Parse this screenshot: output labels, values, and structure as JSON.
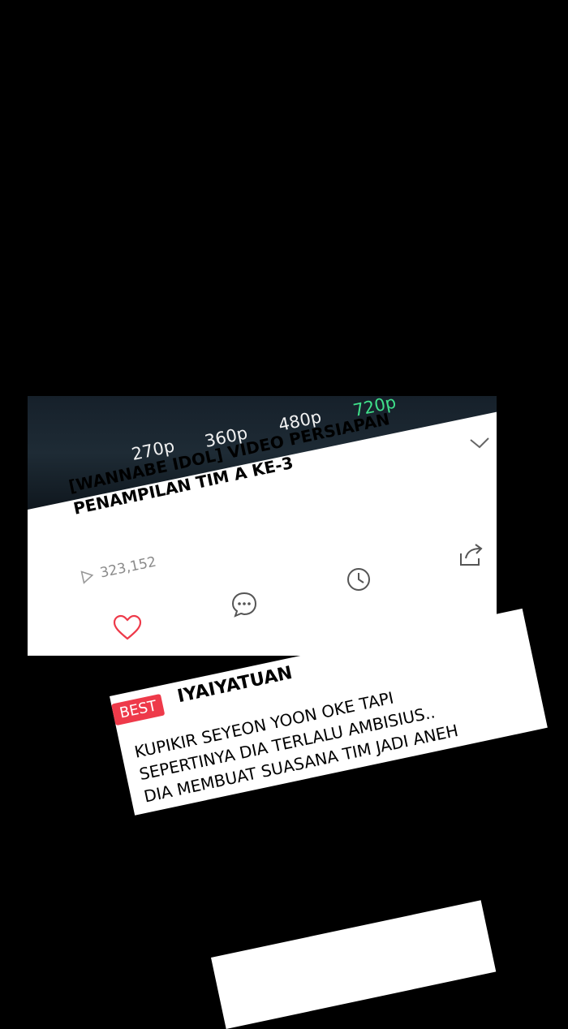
{
  "video": {
    "resolutions": [
      "270p",
      "360p",
      "480p",
      "720p"
    ],
    "selected_resolution": "720p",
    "title_line1": "[WANNABE IDOL] VIDEO PERSIAPAN",
    "title_line2": "PENAMPILAN TIM A KE-3",
    "views": "323,152",
    "icons": {
      "collapse": "chevron-down-icon",
      "share": "share-icon",
      "play": "play-icon",
      "clock": "clock-icon",
      "comment": "comment-icon",
      "like": "heart-icon"
    },
    "accent_active": "#3fe08a",
    "like_color": "#ee3a4a"
  },
  "comment": {
    "badge": "BEST",
    "username": "IYAIYATUAN",
    "text": "KUPIKIR SEYEON YOON OKE TAPI\nSEPERTINYA DIA TERLALU AMBISIUS..\nDIA MEMBUAT SUASANA TIM JADI ANEH",
    "badge_color": "#ee3a4a"
  }
}
